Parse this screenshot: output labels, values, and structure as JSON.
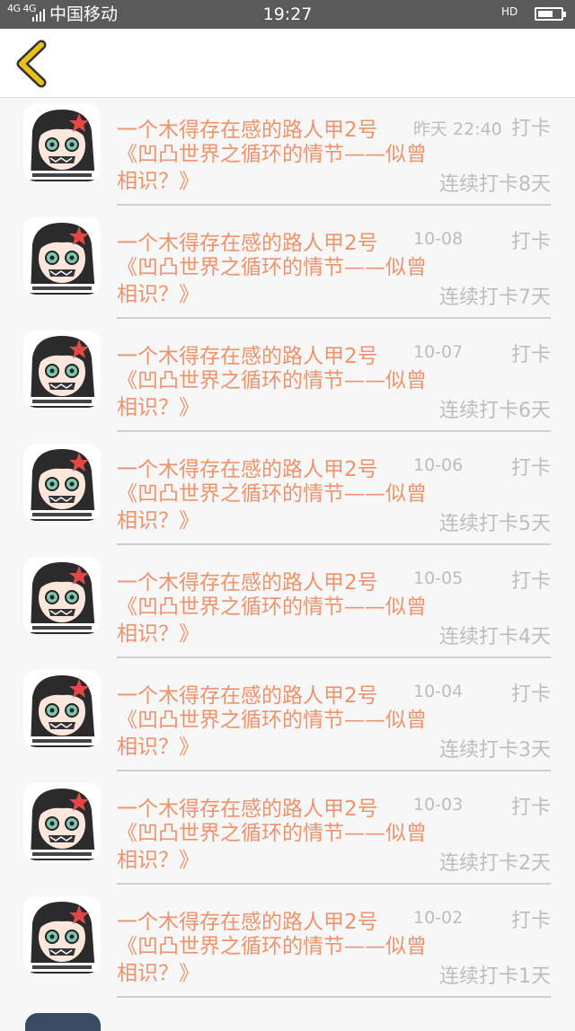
{
  "status_bar": {
    "network": "4G 4G",
    "carrier": "中国移动",
    "time": "19:27",
    "hd": "HD"
  },
  "nav": {
    "back_icon": "chevron-left-icon",
    "accent": "#e8c21a"
  },
  "colors": {
    "name": "#f0926a",
    "meta": "#bdbdbd"
  },
  "items": [
    {
      "name": "一个木得存在感的路人甲2号",
      "date": "昨天 22:40",
      "action": "打卡",
      "title": "《凹凸世界之循环的情节——似曾相识？》",
      "streak": "连续打卡8天"
    },
    {
      "name": "一个木得存在感的路人甲2号",
      "date": "10-08",
      "action": "打卡",
      "title": "《凹凸世界之循环的情节——似曾相识？》",
      "streak": "连续打卡7天"
    },
    {
      "name": "一个木得存在感的路人甲2号",
      "date": "10-07",
      "action": "打卡",
      "title": "《凹凸世界之循环的情节——似曾相识？》",
      "streak": "连续打卡6天"
    },
    {
      "name": "一个木得存在感的路人甲2号",
      "date": "10-06",
      "action": "打卡",
      "title": "《凹凸世界之循环的情节——似曾相识？》",
      "streak": "连续打卡5天"
    },
    {
      "name": "一个木得存在感的路人甲2号",
      "date": "10-05",
      "action": "打卡",
      "title": "《凹凸世界之循环的情节——似曾相识？》",
      "streak": "连续打卡4天"
    },
    {
      "name": "一个木得存在感的路人甲2号",
      "date": "10-04",
      "action": "打卡",
      "title": "《凹凸世界之循环的情节——似曾相识？》",
      "streak": "连续打卡3天"
    },
    {
      "name": "一个木得存在感的路人甲2号",
      "date": "10-03",
      "action": "打卡",
      "title": "《凹凸世界之循环的情节——似曾相识？》",
      "streak": "连续打卡2天"
    },
    {
      "name": "一个木得存在感的路人甲2号",
      "date": "10-02",
      "action": "打卡",
      "title": "《凹凸世界之循环的情节——似曾相识？》",
      "streak": "连续打卡1天"
    }
  ]
}
